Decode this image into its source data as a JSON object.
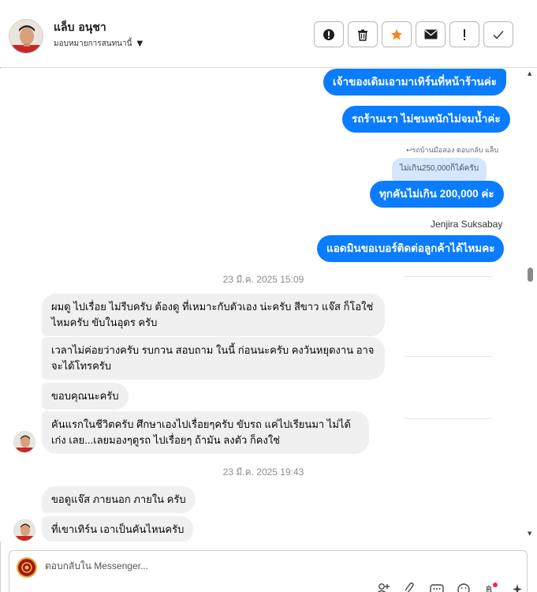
{
  "header": {
    "contact_name": "แล็บ อนุชา",
    "assign_label": "มอบหมายการสนทนานี้",
    "actions": [
      {
        "icon": "alert-circle-icon"
      },
      {
        "icon": "trash-icon"
      },
      {
        "icon": "star-icon"
      },
      {
        "icon": "mail-icon"
      },
      {
        "icon": "exclamation-icon"
      },
      {
        "icon": "check-icon"
      }
    ]
  },
  "messages": {
    "out_1": "เจ้าของเดิมเอามาเทิร์นที่หน้าร้านค่ะ",
    "out_2": "รถร้านเรา ไม่ชนหนักไม่จมน้ำค่ะ",
    "reply_meta": "รถบ้านมือสอง ตอบกลับ แล็บ",
    "reply_quote": "ไม่เกิน250,000ก็ได้ครับ",
    "out_3": "ทุกคันไม่เกิน 200,000 ค่ะ",
    "sender_name": "Jenjira Suksabay",
    "out_4": "แอดมินขอเบอร์ติดต่อลูกค้าได้ไหมคะ",
    "time_1": "23 มี.ค. 2025 15:09",
    "in_1": "ผมดู ไปเรื่อย ไม่รีบครับ  ต้องดู ที่เหมาะกับตัวเอง น่ะครับ  สีขาว  แจ๊ส ก็โอใช่ไหมครับ ขับในอุดร ครับ",
    "in_2": "เวลาไม่ค่อยว่างครับ รบกวน สอบถาม ในนี้ ก่อนนะครับ  คงวันหยุดงาน อาจจะได้โทรครับ",
    "in_3": "ขอบคุณนะครับ",
    "in_4": "คันแรกในชีวิตครับ  ศึกษาเองไปเรื่อยๆครับ   ขับรถ แค่ไปเรียนมา  ไม่ได้เก่ง เลย...เลยมองๆดูรถ ไปเรื่อยๆ  ถ้ามัน ลงตัว ก็คงใช่",
    "time_2": "23 มี.ค. 2025 19:43",
    "in_5": "ขอดูแจ๊ส ภายนอก ภายใน  ครับ",
    "in_6": "ที่เขาเทิร์น เอาเป็นคันไหนครับ"
  },
  "composer": {
    "placeholder": "ตอบกลับใน Messenger...",
    "tools": [
      "add-person-icon",
      "attachment-icon",
      "saved-reply-icon",
      "emoji-icon",
      "currency-icon",
      "sparkle-icon"
    ]
  },
  "colors": {
    "outgoing": "#0a7cff",
    "incoming": "#f0f0f0",
    "reply_quote": "#d6e7fd",
    "star": "#f5831f"
  }
}
